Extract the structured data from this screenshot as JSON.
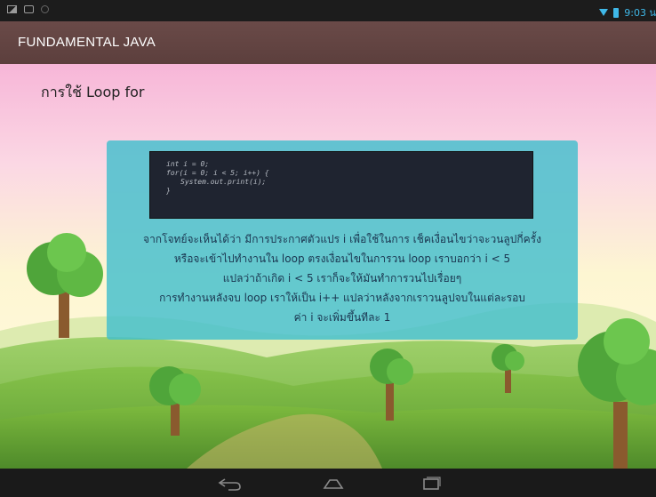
{
  "status_bar": {
    "time": "9:03 น",
    "icons": [
      "photo-icon",
      "message-icon",
      "sync-icon",
      "wifi-icon",
      "battery-icon"
    ]
  },
  "app_bar": {
    "title": "FUNDAMENTAL JAVA"
  },
  "screen": {
    "heading": "การใช้ Loop for",
    "code": [
      "int i = 0;",
      "for(i = 0; i < 5; i++) {",
      "System.out.print(i);",
      "}"
    ],
    "explanation": [
      "จากโจทย์จะเห็นได้ว่า มีการประกาศตัวแปร i เพื่อใช้ในการ เช็คเงื่อนไขว่าจะวนลูปกี่ครั้ง",
      "หรือจะเข้าไปทำงานใน loop ตรงเงื่อนไขในการวน loop เราบอกว่า i < 5",
      "แปลว่าถ้าเกิด i < 5 เราก็จะให้มันทำการวนไปเรื่อยๆ",
      "การทำงานหลังจบ loop เราให้เป็น i++ แปลว่าหลังจากเราวนลูปจบในแต่ละรอบ",
      "ค่า i จะเพิ่มขึ้นทีละ 1"
    ]
  },
  "nav_bar": {
    "icons": [
      "back-icon",
      "home-icon",
      "recent-apps-icon"
    ]
  },
  "colors": {
    "app_bar": "#5c3f3d",
    "panel": "#42becd",
    "code_bg": "#1f2430",
    "status_accent": "#3fb8e8"
  }
}
